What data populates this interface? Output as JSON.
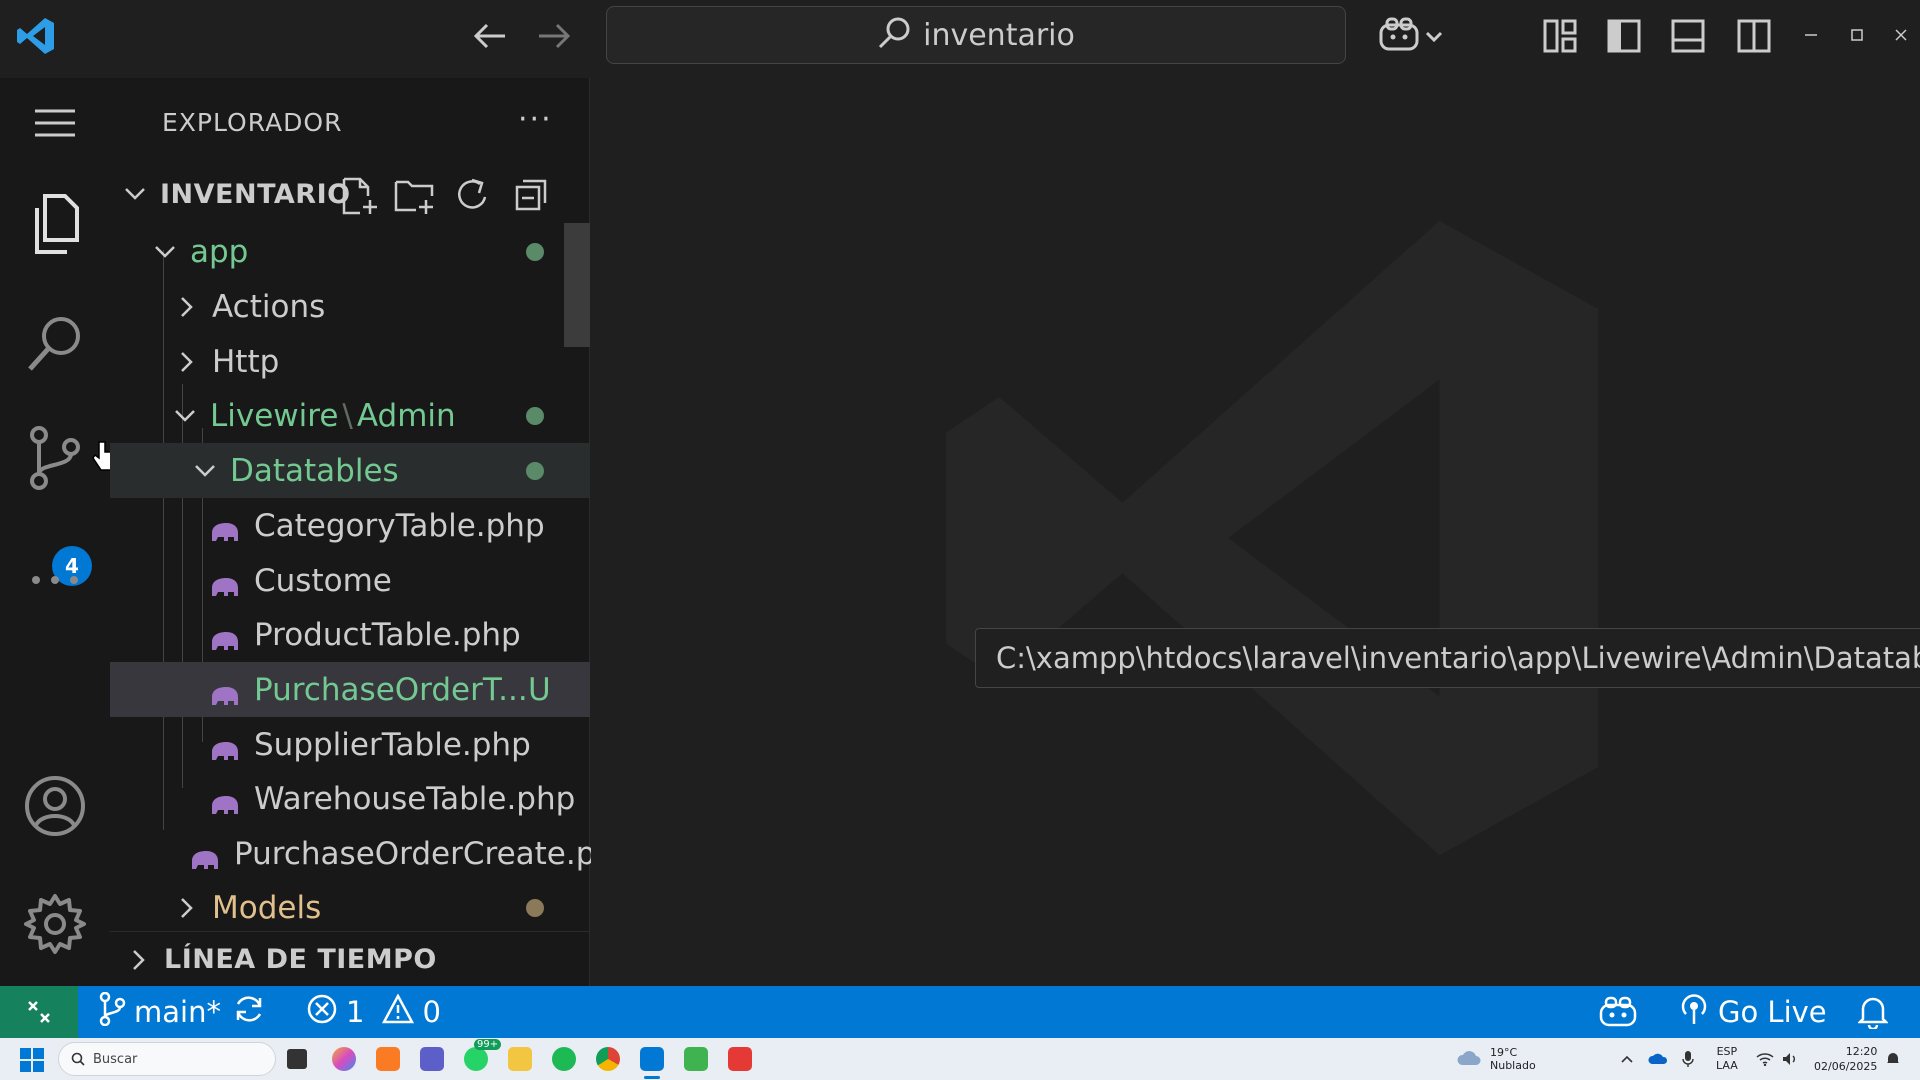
{
  "titlebar": {
    "search_text": "inventario",
    "icons": [
      "vscode-logo",
      "back-arrow",
      "forward-arrow",
      "copilot-icon",
      "customize-layout-icon",
      "toggle-primary-sidebar-icon",
      "toggle-panel-icon",
      "toggle-secondary-sidebar-icon",
      "minimize",
      "maximize",
      "close"
    ]
  },
  "activitybar": {
    "items": [
      "menu-icon",
      "explorer-icon",
      "search-icon",
      "source-control-icon",
      "more-icon",
      "accounts-icon",
      "manage-gear-icon"
    ],
    "source_control_badge": "4"
  },
  "sidebar": {
    "title": "EXPLORADOR",
    "more": "···",
    "workspace": "INVENTARIO",
    "timeline": "LÍNEA DE TIEMPO",
    "tree": [
      {
        "label": "app",
        "type": "folder-open",
        "color": "#73c991"
      },
      {
        "label": "Actions",
        "type": "folder",
        "color": "#cccccc"
      },
      {
        "label": "Http",
        "type": "folder",
        "color": "#cccccc"
      },
      {
        "label_a": "Livewire",
        "sep": "\\",
        "label_b": "Admin",
        "type": "folder-open",
        "color": "#73c991"
      },
      {
        "label": "Datatables",
        "type": "folder-open",
        "color": "#73c991"
      },
      {
        "label": "CategoryTable.php",
        "type": "file",
        "color": "#cccccc"
      },
      {
        "label": "Custome",
        "type": "file",
        "color": "#cccccc"
      },
      {
        "label": "ProductTable.php",
        "type": "file",
        "color": "#cccccc"
      },
      {
        "label": "PurchaseOrderT...",
        "status": "U",
        "type": "file",
        "color": "#73c991"
      },
      {
        "label": "SupplierTable.php",
        "type": "file",
        "color": "#cccccc"
      },
      {
        "label": "WarehouseTable.php",
        "type": "file",
        "color": "#cccccc"
      },
      {
        "label": "PurchaseOrderCreate.p...",
        "type": "file",
        "color": "#cccccc"
      },
      {
        "label": "Models",
        "type": "folder",
        "color": "#e2c08d"
      }
    ]
  },
  "editor": {
    "tooltip": "C:\\xampp\\htdocs\\laravel\\inventario\\app\\Livewire\\Admin\\Datatables\\CategoryTable.php"
  },
  "statusbar": {
    "branch": "main*",
    "errors": "1",
    "warnings": "0",
    "go_live": "Go Live"
  },
  "taskbar": {
    "search_placeholder": "Buscar",
    "whatsapp_badge": "99+",
    "weather_temp": "19°C",
    "weather_desc": "Nublado",
    "lang_1": "ESP",
    "lang_2": "LAA",
    "time": "12:20",
    "date": "02/06/2025"
  },
  "colors": {
    "accent": "#0078d4",
    "git_added": "#73c991",
    "git_modified": "#e2c08d",
    "php_icon": "#a074c4"
  }
}
